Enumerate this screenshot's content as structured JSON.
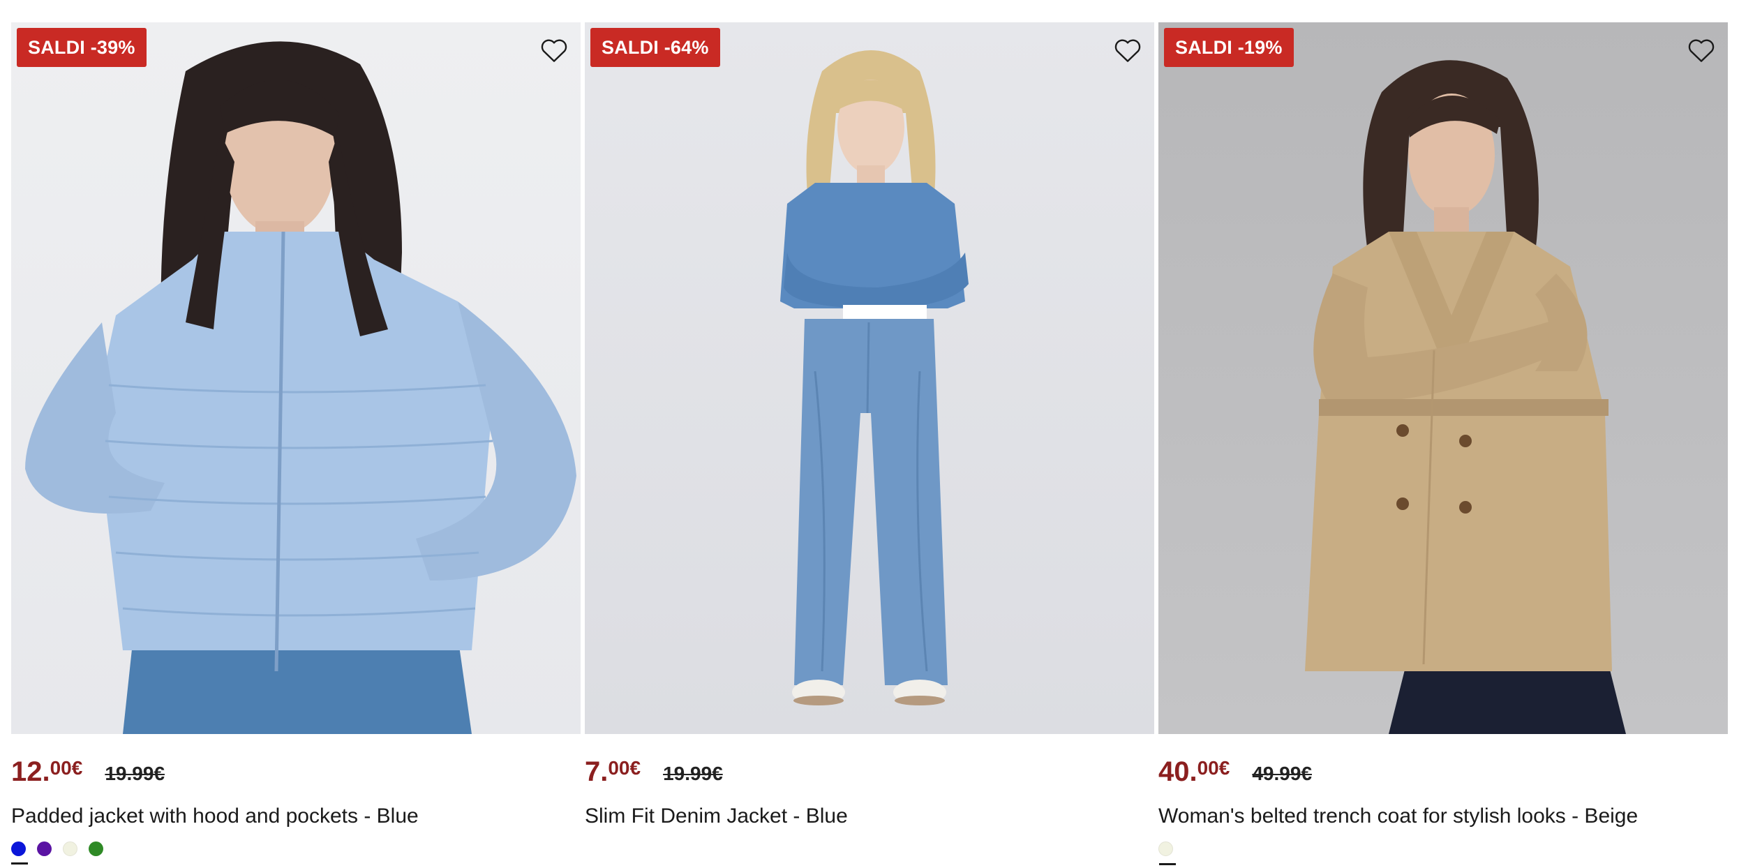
{
  "colors": {
    "sale_badge": "#c92a24",
    "sale_price": "#8b1f1f"
  },
  "products": [
    {
      "badge": "SALDI -39%",
      "price_int": "12.",
      "price_dec": "00€",
      "price_old": "19.99€",
      "name": "Padded jacket with hood and pockets - Blue",
      "wishlist_icon": "heart-outline-icon",
      "swatches": [
        "#0b16d9",
        "#5a13a3",
        "#f1f2e1",
        "#2f8a26"
      ]
    },
    {
      "badge": "SALDI -64%",
      "price_int": "7.",
      "price_dec": "00€",
      "price_old": "19.99€",
      "name": "Slim Fit Denim Jacket - Blue",
      "wishlist_icon": "heart-outline-icon",
      "swatches": []
    },
    {
      "badge": "SALDI -19%",
      "price_int": "40.",
      "price_dec": "00€",
      "price_old": "49.99€",
      "name": "Woman's belted trench coat for stylish looks - Beige",
      "wishlist_icon": "heart-outline-icon",
      "swatches": [
        "#f1f2e1"
      ]
    }
  ]
}
